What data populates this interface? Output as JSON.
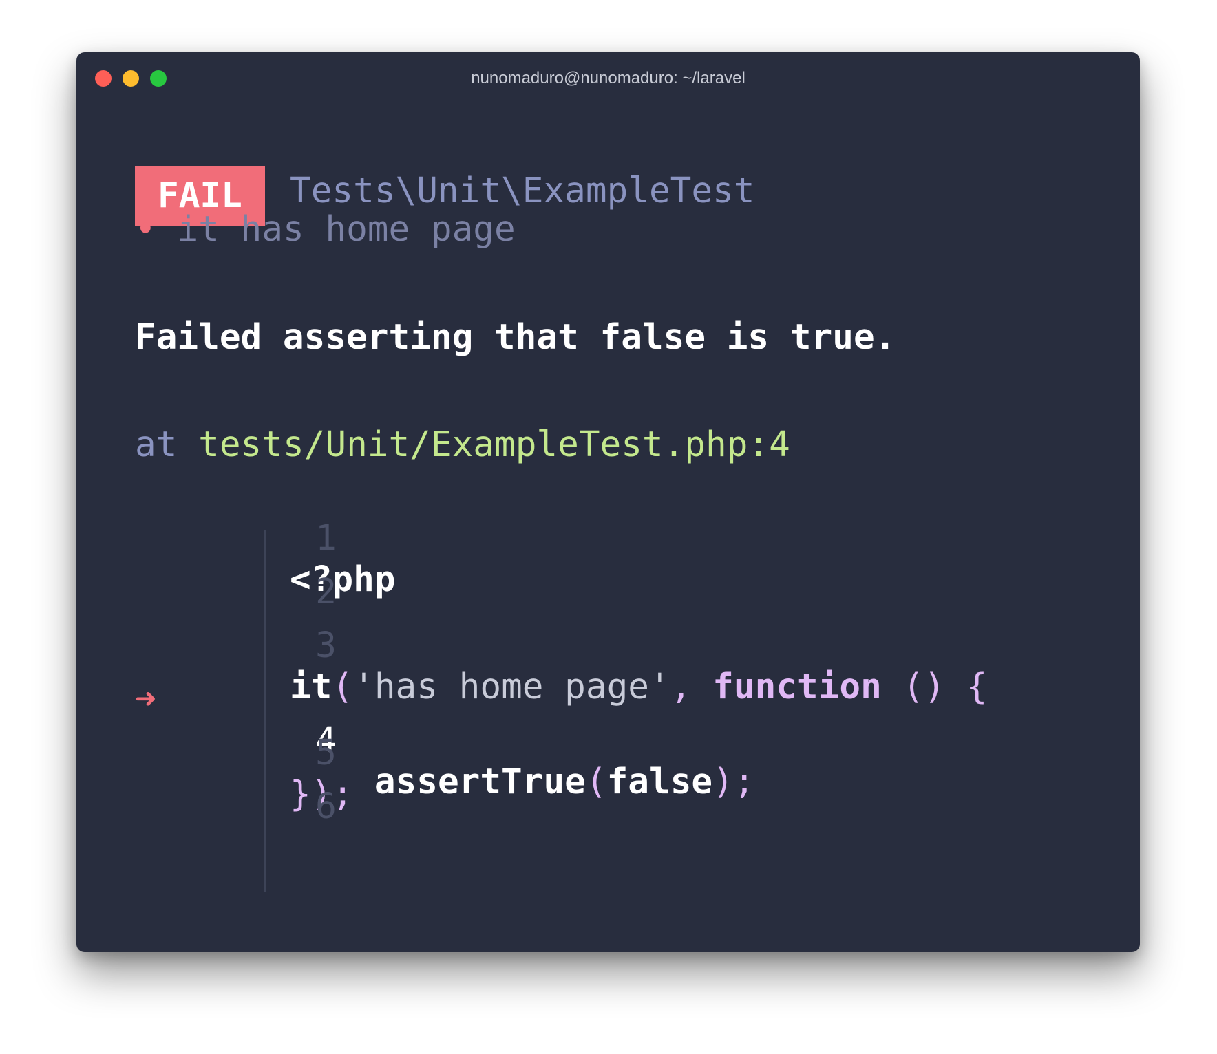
{
  "window": {
    "title": "nunomaduro@nunomaduro: ~/laravel"
  },
  "result": {
    "status": "FAIL",
    "test_class": "Tests\\Unit\\ExampleTest",
    "bullet": "•",
    "test_name": "it has home page"
  },
  "failure": {
    "message": "Failed asserting that false is true.",
    "at_label": "at",
    "location": "tests/Unit/ExampleTest.php:4"
  },
  "code": {
    "arrow": "➜",
    "lines": [
      {
        "number": "1",
        "text": "<?php"
      },
      {
        "number": "2",
        "text": ""
      },
      {
        "number": "3",
        "call": "it",
        "open": "(",
        "string": "'has home page'",
        "comma": ",",
        "keyword": "function",
        "parens": "()",
        "brace": "{"
      },
      {
        "number": "4",
        "indent": "    ",
        "call": "assertTrue",
        "open": "(",
        "arg": "false",
        "close": ")",
        "semi": ";"
      },
      {
        "number": "5",
        "text": "});"
      },
      {
        "number": "6",
        "text": ""
      }
    ]
  },
  "colors": {
    "background": "#282d3e",
    "fail_badge": "#f16d79",
    "path": "#c4e88d",
    "keyword": "#e0b8f5",
    "muted": "#8a93c0"
  }
}
